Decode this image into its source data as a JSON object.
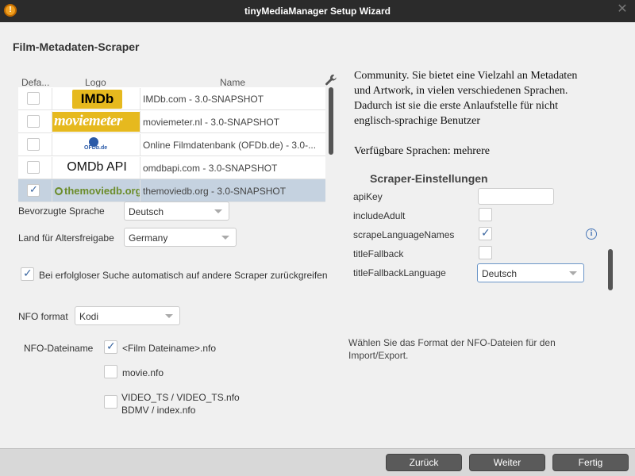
{
  "window": {
    "title": "tinyMediaManager Setup Wizard",
    "app_icon": "tmm-app-icon",
    "close_glyph": "✕"
  },
  "page": {
    "title": "Film-Metadaten-Scraper"
  },
  "table": {
    "columns": {
      "default": "Defa...",
      "logo": "Logo",
      "name": "Name"
    },
    "rows": [
      {
        "checked": false,
        "logo_text": "IMDb",
        "name": "IMDb.com - 3.0-SNAPSHOT"
      },
      {
        "checked": false,
        "logo_text": "moviemeter",
        "name": "moviemeter.nl - 3.0-SNAPSHOT"
      },
      {
        "checked": false,
        "logo_text": "OFDb.de",
        "name": "Online Filmdatenbank (OFDb.de) - 3.0-..."
      },
      {
        "checked": false,
        "logo_text": "OMDb API",
        "name": "omdbapi.com - 3.0-SNAPSHOT"
      },
      {
        "checked": true,
        "logo_text": "themoviedb.org",
        "name": "themoviedb.org - 3.0-SNAPSHOT"
      }
    ]
  },
  "form": {
    "language_label": "Bevorzugte Sprache",
    "language_value": "Deutsch",
    "country_label": "Land für Altersfreigabe",
    "country_value": "Germany",
    "fallback_label": "Bei erfolgloser Suche automatisch auf andere Scraper zurückgreifen",
    "fallback_checked": true,
    "nfo_format_label": "NFO format",
    "nfo_format_value": "Kodi",
    "nfo_filename_label": "NFO-Dateiname",
    "nfo_options": [
      {
        "label": "<Film Dateiname>.nfo",
        "checked": true
      },
      {
        "label": "movie.nfo",
        "checked": false
      },
      {
        "label": "VIDEO_TS / VIDEO_TS.nfo",
        "label2": "BDMV / index.nfo",
        "checked": false
      }
    ]
  },
  "description": {
    "line1": "Community. Sie bietet eine Vielzahl an Metadaten",
    "line2": "und Artwork, in vielen verschiedenen Sprachen.",
    "line3": "Dadurch ist sie die erste Anlaufstelle für nicht",
    "line4": "englisch-sprachige Benutzer",
    "languages": "Verfügbare Sprachen: mehrere"
  },
  "scraper_settings": {
    "title": "Scraper-Einstellungen",
    "api_key_label": "apiKey",
    "api_key_value": "",
    "include_adult_label": "includeAdult",
    "include_adult": false,
    "scrape_language_names_label": "scrapeLanguageNames",
    "scrape_language_names": true,
    "title_fallback_label": "titleFallback",
    "title_fallback": false,
    "title_fallback_language_label": "titleFallbackLanguage",
    "title_fallback_language_value": "Deutsch"
  },
  "hint": "Wählen Sie das Format der NFO-Dateien für den Import/Export.",
  "buttons": {
    "back": "Zurück",
    "next": "Weiter",
    "finish": "Fertig"
  },
  "colors": {
    "titlebar": "#2b2b2b",
    "content_bg": "#f0f0f0",
    "selected_row": "#c5d2e0",
    "button": "#5a5a5a",
    "imdb_yellow": "#e6b91e"
  }
}
